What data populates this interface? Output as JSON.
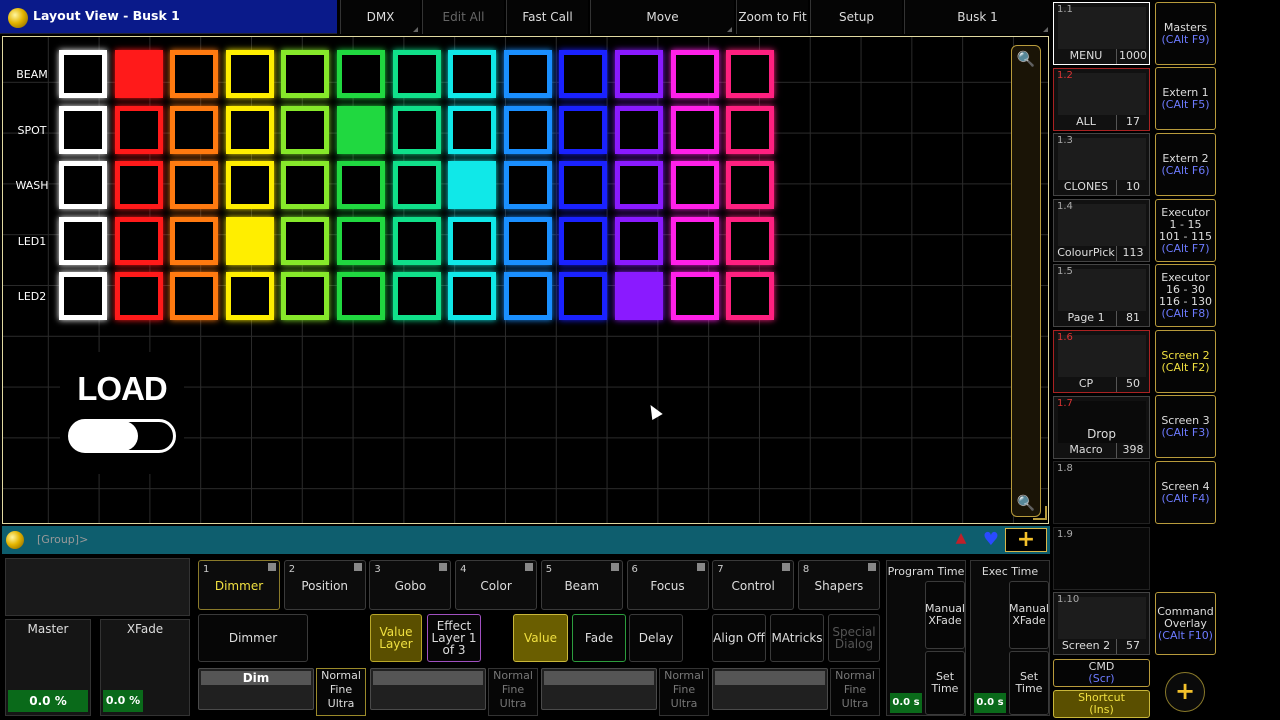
{
  "title": "Layout View - Busk 1",
  "toolbar": [
    "DMX",
    "Edit All",
    "Fast Call",
    "Move",
    "Zoom to Fit",
    "Setup",
    "Busk 1"
  ],
  "rows": [
    "BEAM",
    "SPOT",
    "WASH",
    "LED1",
    "LED2"
  ],
  "colors": [
    "#ffffff",
    "#ff1a1a",
    "#ff7a10",
    "#ffee00",
    "#86e82a",
    "#20d840",
    "#10e08a",
    "#10e8e8",
    "#1a8fff",
    "#1a22ff",
    "#8a1aff",
    "#ff20e8",
    "#ff2080"
  ],
  "filled": [
    [
      0,
      1
    ],
    [
      1,
      5
    ],
    [
      2,
      7
    ],
    [
      3,
      3
    ],
    [
      4,
      10
    ]
  ],
  "load_label": "LOAD",
  "views": [
    {
      "num": "1.1",
      "label": "MENU",
      "count": "1000"
    },
    {
      "num": "1.2",
      "label": "ALL",
      "count": "17"
    },
    {
      "num": "1.3",
      "label": "CLONES",
      "count": "10"
    },
    {
      "num": "1.4",
      "label": "ColourPick",
      "count": "113"
    },
    {
      "num": "1.5",
      "label": "Page 1",
      "count": "81"
    },
    {
      "num": "1.6",
      "label": "CP",
      "count": "50"
    },
    {
      "num": "1.7",
      "label": "Macro",
      "count": "398",
      "extra": "Drop"
    },
    {
      "num": "1.8",
      "label": "",
      "count": ""
    },
    {
      "num": "1.9",
      "label": "",
      "count": ""
    },
    {
      "num": "1.10",
      "label": "Screen 2",
      "count": "57"
    }
  ],
  "screens": [
    {
      "l1": "Masters",
      "s": "(CAlt F9)"
    },
    {
      "l1": "Extern 1",
      "s": "(CAlt F5)"
    },
    {
      "l1": "Extern 2",
      "s": "(CAlt F6)"
    },
    {
      "l1": "Executor",
      "l2": "1 - 15",
      "l3": "101 - 115",
      "s": "(CAlt F7)"
    },
    {
      "l1": "Executor",
      "l2": "16 - 30",
      "l3": "116 - 130",
      "s": "(CAlt F8)"
    },
    {
      "l1": "Screen 2",
      "s": "(CAlt F2)"
    },
    {
      "l1": "Screen 3",
      "s": "(CAlt F3)"
    },
    {
      "l1": "Screen 4",
      "s": "(CAlt F4)"
    },
    {
      "l1": "Command",
      "l2": "Overlay",
      "s": "(CAlt F10)"
    }
  ],
  "cmdline": "[Group]>",
  "features": [
    {
      "n": "1",
      "l": "Dimmer"
    },
    {
      "n": "2",
      "l": "Position"
    },
    {
      "n": "3",
      "l": "Gobo"
    },
    {
      "n": "4",
      "l": "Color"
    },
    {
      "n": "5",
      "l": "Beam"
    },
    {
      "n": "6",
      "l": "Focus"
    },
    {
      "n": "7",
      "l": "Control"
    },
    {
      "n": "8",
      "l": "Shapers"
    }
  ],
  "bottom": {
    "master": "Master",
    "xfade": "XFade",
    "master_pct": "0.0 %",
    "xfade_pct": "0.0 %",
    "dimmer": "Dimmer",
    "value_layer": "Value Layer",
    "effect_layer": "Effect Layer 1 of 3",
    "value": "Value",
    "fade": "Fade",
    "delay": "Delay",
    "align": "Align Off",
    "matricks": "MAtricks",
    "special": "Special Dialog",
    "dim": "Dim",
    "nfu": "Normal Fine Ultra",
    "program_time": "Program Time",
    "exec_time": "Exec Time",
    "manual_xfade": "Manual XFade",
    "set_time": "Set Time",
    "zero_s": "0.0 s",
    "cmd": "CMD",
    "cmd_s": "(Scr)",
    "shortcut": "Shortcut",
    "shortcut_s": "(Ins)"
  }
}
